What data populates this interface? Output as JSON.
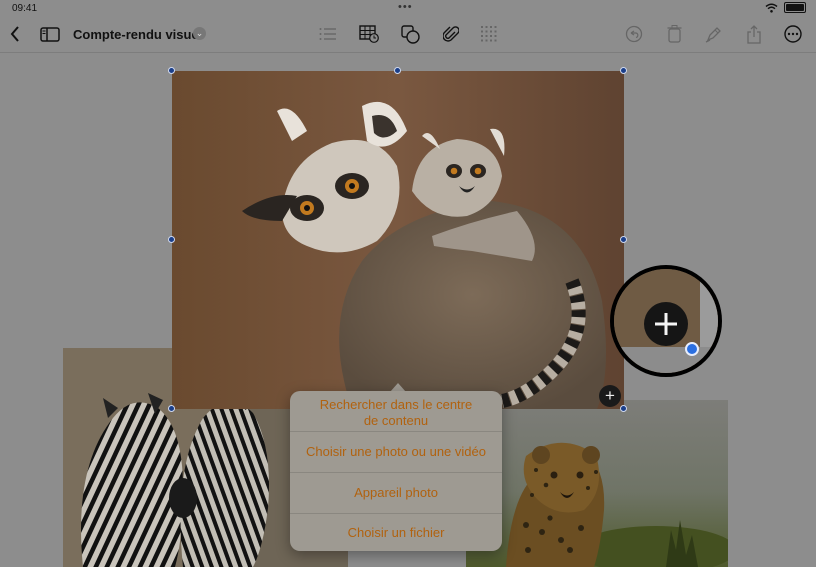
{
  "status": {
    "time": "09:41",
    "dots": "•••"
  },
  "toolbar": {
    "title": "Compte-rendu visuel",
    "buttons": [
      "back-icon",
      "sidebar-icon",
      "list-icon",
      "table-icon",
      "shapes-icon",
      "attachment-icon",
      "grid-icon",
      "undo-icon",
      "trash-icon",
      "pen-icon",
      "share-icon",
      "more-icon"
    ]
  },
  "menu": {
    "items": [
      {
        "line1": "Rechercher dans le centre",
        "line2": "de contenu"
      },
      {
        "line1": "Choisir une photo ou une vidéo"
      },
      {
        "line1": "Appareil photo"
      },
      {
        "line1": "Choisir un fichier"
      }
    ]
  },
  "colors": {
    "menu_text": "#b1620f",
    "selection_handle": "#1b3f8a"
  }
}
